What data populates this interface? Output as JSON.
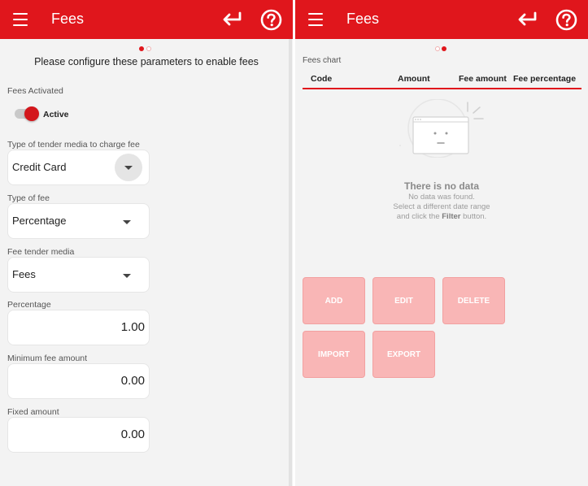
{
  "left_screen": {
    "header": {
      "title": "Fees",
      "menu_icon": "hamburger-menu-icon",
      "back_icon": "return-arrow-icon",
      "help_icon": "question-circle-icon"
    },
    "page_indicator": {
      "count": 2,
      "active_index": 0
    },
    "intro_text": "Please configure these parameters to enable fees",
    "fees_activated": {
      "label": "Fees Activated",
      "toggle_on": true,
      "state_label": "Active"
    },
    "tender_media": {
      "label": "Type of tender media to charge fee",
      "value": "Credit Card"
    },
    "fee_type": {
      "label": "Type of fee",
      "value": "Percentage"
    },
    "fee_tender_media": {
      "label": "Fee tender media",
      "value": "Fees"
    },
    "percentage": {
      "label": "Percentage",
      "value": "1.00"
    },
    "minimum_fee": {
      "label": "Minimum fee amount",
      "value": "0.00"
    },
    "fixed_amount": {
      "label": "Fixed amount",
      "value": "0.00"
    }
  },
  "right_screen": {
    "header": {
      "title": "Fees",
      "menu_icon": "hamburger-menu-icon",
      "back_icon": "return-arrow-icon",
      "help_icon": "question-circle-icon"
    },
    "page_indicator": {
      "count": 2,
      "active_index": 1
    },
    "chart_label": "Fees chart",
    "columns": [
      "Code",
      "Amount",
      "Fee amount",
      "Fee percentage"
    ],
    "empty_state": {
      "icon": "empty-browser-window-icon",
      "title": "There is no data",
      "line1": "No data was found.",
      "line2": "Select a different date range",
      "line3_prefix": "and click the ",
      "line3_bold": "Filter",
      "line3_suffix": " button."
    },
    "buttons": {
      "add": "ADD",
      "edit": "EDIT",
      "delete": "DELETE",
      "import": "IMPORT",
      "export": "EXPORT"
    }
  },
  "colors": {
    "accent": "#e0161c",
    "background": "#f3f3f3",
    "button_disabled": "#f9b6b6"
  }
}
